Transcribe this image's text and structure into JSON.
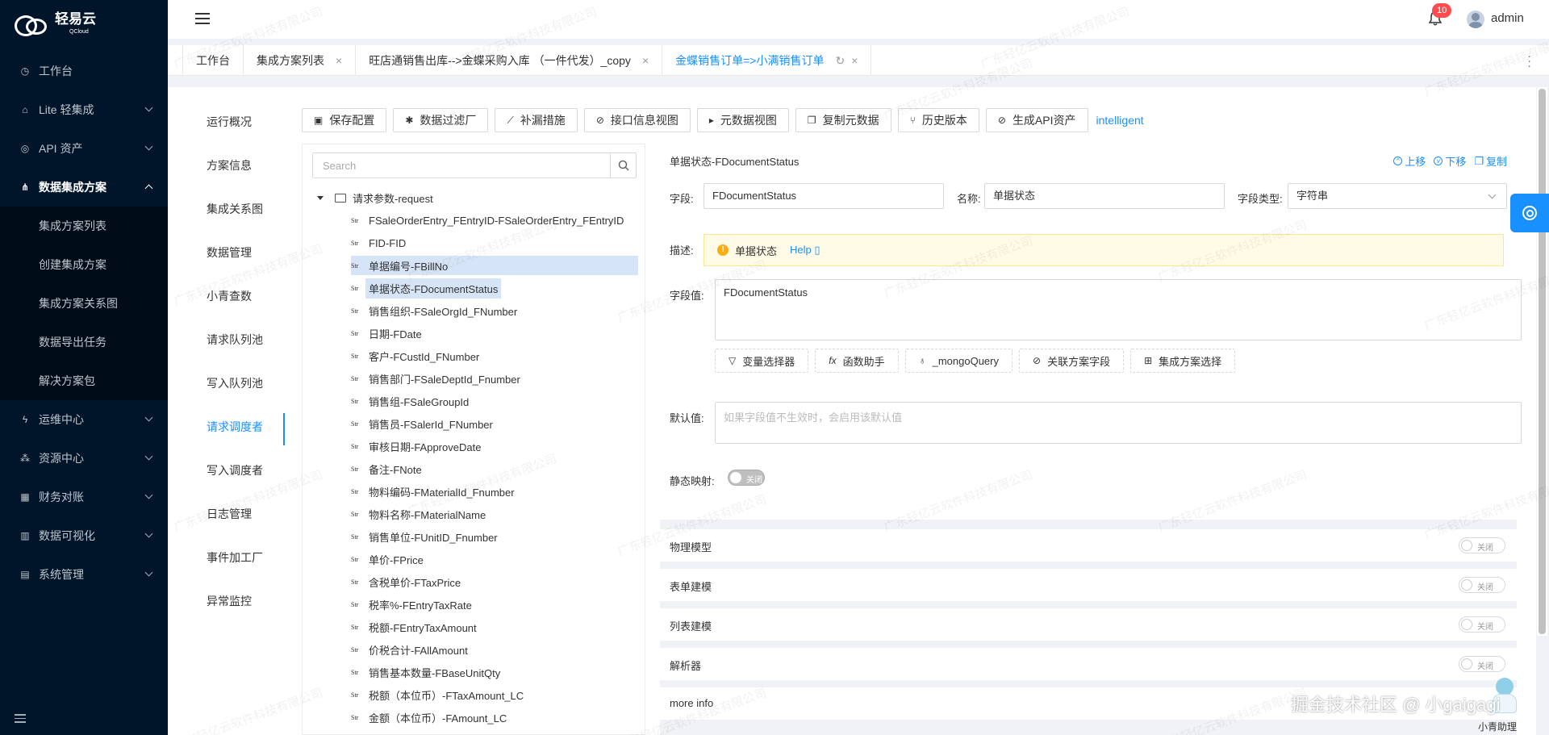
{
  "app": {
    "brand": "轻易云",
    "brand_sub": "QCloud"
  },
  "sidebar": {
    "items": [
      {
        "label": "工作台",
        "icon": "clock-icon"
      },
      {
        "label": "Lite 轻集成",
        "icon": "bank-icon"
      },
      {
        "label": "API 资产",
        "icon": "compass-icon"
      },
      {
        "label": "数据集成方案",
        "icon": "deployment-icon"
      },
      {
        "label": "运维中心",
        "icon": "thunder-icon"
      },
      {
        "label": "资源中心",
        "icon": "cluster-icon"
      },
      {
        "label": "财务对账",
        "icon": "calculator-icon"
      },
      {
        "label": "数据可视化",
        "icon": "chart-icon"
      },
      {
        "label": "系统管理",
        "icon": "partition-icon"
      }
    ],
    "submenu": [
      "集成方案列表",
      "创建集成方案",
      "集成方案关系图",
      "数据导出任务",
      "解决方案包"
    ]
  },
  "header": {
    "notification_count": "10",
    "username": "admin"
  },
  "tabs": [
    {
      "label": "工作台"
    },
    {
      "label": "集成方案列表",
      "close": "×"
    },
    {
      "label": "旺店通销售出库-->金蝶采购入库 （一件代发）_copy",
      "close": "×"
    },
    {
      "label": "金蝶销售订单=>小满销售订单",
      "close": "×",
      "refresh": "↻"
    }
  ],
  "subnav": [
    "运行概况",
    "方案信息",
    "集成关系图",
    "数据管理",
    "小青查数",
    "请求队列池",
    "写入队列池",
    "请求调度者",
    "写入调度者",
    "日志管理",
    "事件加工厂",
    "异常监控"
  ],
  "toolbar": {
    "buttons": [
      "保存配置",
      "数据过滤厂",
      "补漏措施",
      "接口信息视图",
      "元数据视图",
      "复制元数据",
      "历史版本",
      "生成API资产"
    ],
    "link": "intelligent"
  },
  "tree": {
    "search_placeholder": "Search",
    "root": "请求参数-request",
    "str_tag": "Str",
    "items": [
      "FSaleOrderEntry_FEntryID-FSaleOrderEntry_FEntryID",
      "FID-FID",
      "单据编号-FBillNo",
      "单据状态-FDocumentStatus",
      "销售组织-FSaleOrgId_FNumber",
      "日期-FDate",
      "客户-FCustId_FNumber",
      "销售部门-FSaleDeptId_Fnumber",
      "销售组-FSaleGroupId",
      "销售员-FSalerId_FNumber",
      "审核日期-FApproveDate",
      "备注-FNote",
      "物料编码-FMaterialId_Fnumber",
      "物料名称-FMaterialName",
      "销售单位-FUnitID_Fnumber",
      "单价-FPrice",
      "含税单价-FTaxPrice",
      "税率%-FEntryTaxRate",
      "税额-FEntryTaxAmount",
      "价税合计-FAllAmount",
      "销售基本数量-FBaseUnitQty",
      "税额（本位币）-FTaxAmount_LC",
      "金额（本位币）-FAmount_LC"
    ],
    "selected_index": 3
  },
  "detail": {
    "title": "单据状态-FDocumentStatus",
    "actions": [
      "上移",
      "下移",
      "复制"
    ],
    "field_label": "字段:",
    "field_value": "FDocumentStatus",
    "name_label": "名称:",
    "name_value": "单据状态",
    "type_label": "字段类型:",
    "type_value": "字符串",
    "desc_label": "描述:",
    "desc_text": "单据状态",
    "help": "Help",
    "value_label": "字段值:",
    "value_text": "FDocumentStatus",
    "value_buttons": [
      "变量选择器",
      "函数助手",
      "_mongoQuery",
      "关联方案字段",
      "集成方案选择"
    ],
    "default_label": "默认值:",
    "default_placeholder": "如果字段值不生效时，会启用该默认值",
    "static_label": "静态映射:",
    "switch_off": "关闭"
  },
  "sections": [
    "物理模型",
    "表单建模",
    "列表建模",
    "解析器",
    "more info"
  ],
  "watermark": "广东轻亿云软件科技有限公司",
  "footer": {
    "overlay": "掘金技术社区 @ 小gaigagi",
    "assistant": "小青助理"
  }
}
